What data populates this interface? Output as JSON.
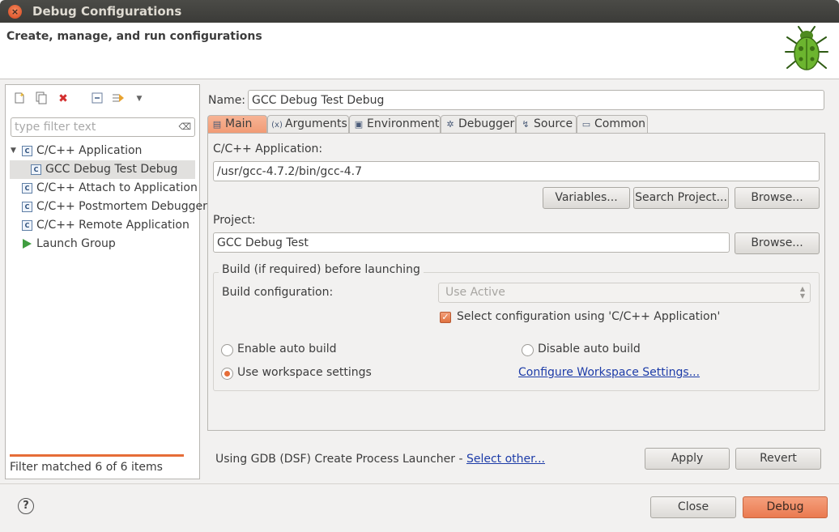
{
  "window": {
    "title": "Debug Configurations",
    "close_glyph": "×"
  },
  "header": {
    "heading": "Create, manage, and run configurations"
  },
  "left": {
    "filter": {
      "placeholder": "type filter text",
      "clear_glyph": "⌫"
    },
    "tree": [
      {
        "label": "C/C++ Application",
        "icon": "c-file-icon",
        "expanded": true
      },
      {
        "label": "GCC Debug Test Debug",
        "icon": "c-file-icon",
        "selected": true
      },
      {
        "label": "C/C++ Attach to Application",
        "icon": "c-file-icon"
      },
      {
        "label": "C/C++ Postmortem Debugger",
        "icon": "c-file-icon"
      },
      {
        "label": "C/C++ Remote Application",
        "icon": "c-file-icon"
      },
      {
        "label": "Launch Group",
        "icon": "play-icon"
      }
    ],
    "status": "Filter matched 6 of 6 items"
  },
  "config": {
    "name_label": "Name:",
    "name_value": "GCC Debug Test Debug"
  },
  "tabs": [
    {
      "label": "Main",
      "icon": "main-tab-icon",
      "active": true
    },
    {
      "label": "Arguments",
      "icon": "arguments-tab-icon"
    },
    {
      "label": "Environment",
      "icon": "environment-tab-icon"
    },
    {
      "label": "Debugger",
      "icon": "debugger-tab-icon"
    },
    {
      "label": "Source",
      "icon": "source-tab-icon"
    },
    {
      "label": "Common",
      "icon": "common-tab-icon"
    }
  ],
  "main": {
    "app_label": "C/C++ Application:",
    "app_value": "/usr/gcc-4.7.2/bin/gcc-4.7",
    "variables_button": "Variables...",
    "search_project_button": "Search Project...",
    "browse_app_button": "Browse...",
    "project_label": "Project:",
    "project_value": "GCC Debug Test",
    "browse_project_button": "Browse...",
    "build_group_title": "Build (if required) before launching",
    "build_config_label": "Build configuration:",
    "build_config_value": "Use Active",
    "select_config_checkbox": "Select configuration using 'C/C++ Application'",
    "enable_auto_build": "Enable auto build",
    "disable_auto_build": "Disable auto build",
    "use_workspace_settings": "Use workspace settings",
    "configure_workspace_link": "Configure Workspace Settings..."
  },
  "launcher": {
    "text": "Using GDB (DSF) Create Process Launcher - ",
    "link": "Select other..."
  },
  "actions": {
    "apply": "Apply",
    "revert": "Revert",
    "close": "Close",
    "debug": "Debug"
  },
  "help_glyph": "?",
  "colors": {
    "accent": "#e66d38",
    "link": "#1d3ca8"
  }
}
